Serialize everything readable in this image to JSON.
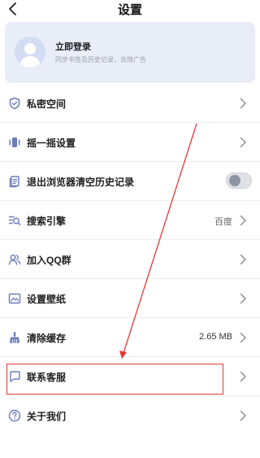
{
  "header": {
    "title": "设置"
  },
  "login": {
    "title": "立即登录",
    "subtitle": "同步书签及历史记录，去除广告"
  },
  "settings": {
    "privacy": {
      "label": "私密空间"
    },
    "shake": {
      "label": "摇一摇设置"
    },
    "clear_on_exit": {
      "label": "退出浏览器清空历史记录",
      "enabled": false
    },
    "search_engine": {
      "label": "搜索引擎",
      "value": "百度"
    },
    "qq_group": {
      "label": "加入QQ群"
    },
    "wallpaper": {
      "label": "设置壁纸"
    },
    "cache": {
      "label": "清除缓存",
      "value": "2.65 MB"
    },
    "contact": {
      "label": "联系客服"
    },
    "about": {
      "label": "关于我们"
    }
  },
  "colors": {
    "icon": "#6b7bbf",
    "card": "#e9edf8",
    "annotation": "#e53935"
  }
}
